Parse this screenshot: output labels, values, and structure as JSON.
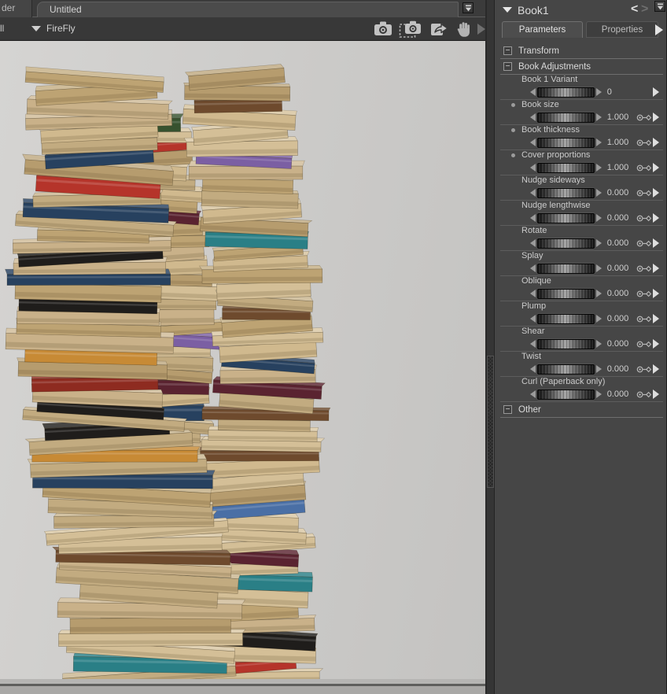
{
  "window": {
    "doc_tab_partial": "der",
    "doc_tab": "Untitled",
    "render_mode_partial": "ll",
    "renderer": "FireFly"
  },
  "panel": {
    "title": "Book1",
    "prev_glyph": "<",
    "next_glyph": ">",
    "tabs": [
      {
        "label": "Parameters",
        "active": true
      },
      {
        "label": "Properties",
        "active": false
      }
    ],
    "sections": {
      "transform": "Transform",
      "adjustments": "Book Adjustments",
      "other": "Other",
      "collapse_glyph": "−"
    },
    "dials": [
      {
        "label": "Book 1 Variant",
        "value": "0",
        "bullet": false,
        "key": false
      },
      {
        "label": "Book size",
        "value": "1.000",
        "bullet": true,
        "key": true
      },
      {
        "label": "Book thickness",
        "value": "1.000",
        "bullet": true,
        "key": true
      },
      {
        "label": "Cover proportions",
        "value": "1.000",
        "bullet": true,
        "key": true
      },
      {
        "label": "Nudge sideways",
        "value": "0.000",
        "bullet": false,
        "key": true
      },
      {
        "label": "Nudge lengthwise",
        "value": "0.000",
        "bullet": false,
        "key": true
      },
      {
        "label": "Rotate",
        "value": "0.000",
        "bullet": false,
        "key": true
      },
      {
        "label": "Splay",
        "value": "0.000",
        "bullet": false,
        "key": true
      },
      {
        "label": "Oblique",
        "value": "0.000",
        "bullet": false,
        "key": true
      },
      {
        "label": "Plump",
        "value": "0.000",
        "bullet": false,
        "key": true
      },
      {
        "label": "Shear",
        "value": "0.000",
        "bullet": false,
        "key": true
      },
      {
        "label": "Twist",
        "value": "0.000",
        "bullet": false,
        "key": true
      },
      {
        "label": "Curl (Paperback only)",
        "value": "0.000",
        "bullet": false,
        "key": true
      }
    ]
  },
  "icons": {
    "camera": "render-camera",
    "camera_area": "area-render-camera",
    "export": "export-arrow",
    "hand": "pan-hand",
    "next": "next-arrow",
    "dropdown": "dropdown-chevron",
    "keyframe": "keyframe-dial"
  },
  "viewport": {
    "floorY": 815,
    "colorChance": 0.52,
    "pageColors": [
      "#c9b189",
      "#d4bf97",
      "#bda373",
      "#c2ab80",
      "#d0b98e",
      "#b69c6e"
    ],
    "spineColors": [
      "#8e2b20",
      "#27415f",
      "#37522f",
      "#1f1d1b",
      "#6e4a2d",
      "#7b5fa3",
      "#b5342a",
      "#2a7f86",
      "#c78a35",
      "#d8d4c8",
      "#4a6fa5",
      "#5a2330"
    ],
    "stacks": [
      {
        "name": "middle-stack",
        "seed": 77,
        "count": 46,
        "yTop": 88,
        "yBottom": 815,
        "cxTop": 206,
        "cxBottom": 226,
        "wTop": 96,
        "wBottom": 106,
        "sway": 15,
        "swayFreq": 1.4,
        "swayPhase": 2.2,
        "tilt": 10
      },
      {
        "name": "right-stack",
        "seed": 913,
        "count": 48,
        "yTop": 28,
        "yBottom": 815,
        "cxTop": 318,
        "cxBottom": 331,
        "wTop": 132,
        "wBottom": 150,
        "sway": 17,
        "swayFreq": 1.1,
        "swayPhase": 4.0,
        "tilt": 10
      },
      {
        "name": "left-stack",
        "seed": 424,
        "count": 48,
        "yTop": 34,
        "yBottom": 815,
        "cxTop": 100,
        "cxBottom": 178,
        "wTop": 162,
        "wBottom": 212,
        "sway": 21,
        "swayFreq": 1.2,
        "swayPhase": 0.6,
        "tilt": 9
      }
    ]
  }
}
